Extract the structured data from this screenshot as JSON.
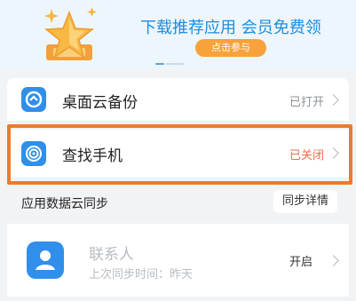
{
  "banner": {
    "title": "下载推荐应用 会员免费领",
    "button": "点击参与"
  },
  "desktop_backup": {
    "label": "桌面云备份",
    "status": "已打开"
  },
  "find_phone": {
    "label": "查找手机",
    "status": "已关闭"
  },
  "app_sync": {
    "section_title": "应用数据云同步",
    "details_button": "同步详情"
  },
  "contacts": {
    "name": "联系人",
    "last_sync": "上次同步时间：昨天",
    "toggle_label": "开启"
  },
  "colors": {
    "accent": "#2f8fea",
    "highlight": "#f07a2a",
    "closed": "#f26b4d",
    "banner_cta": "#f7a23a"
  }
}
